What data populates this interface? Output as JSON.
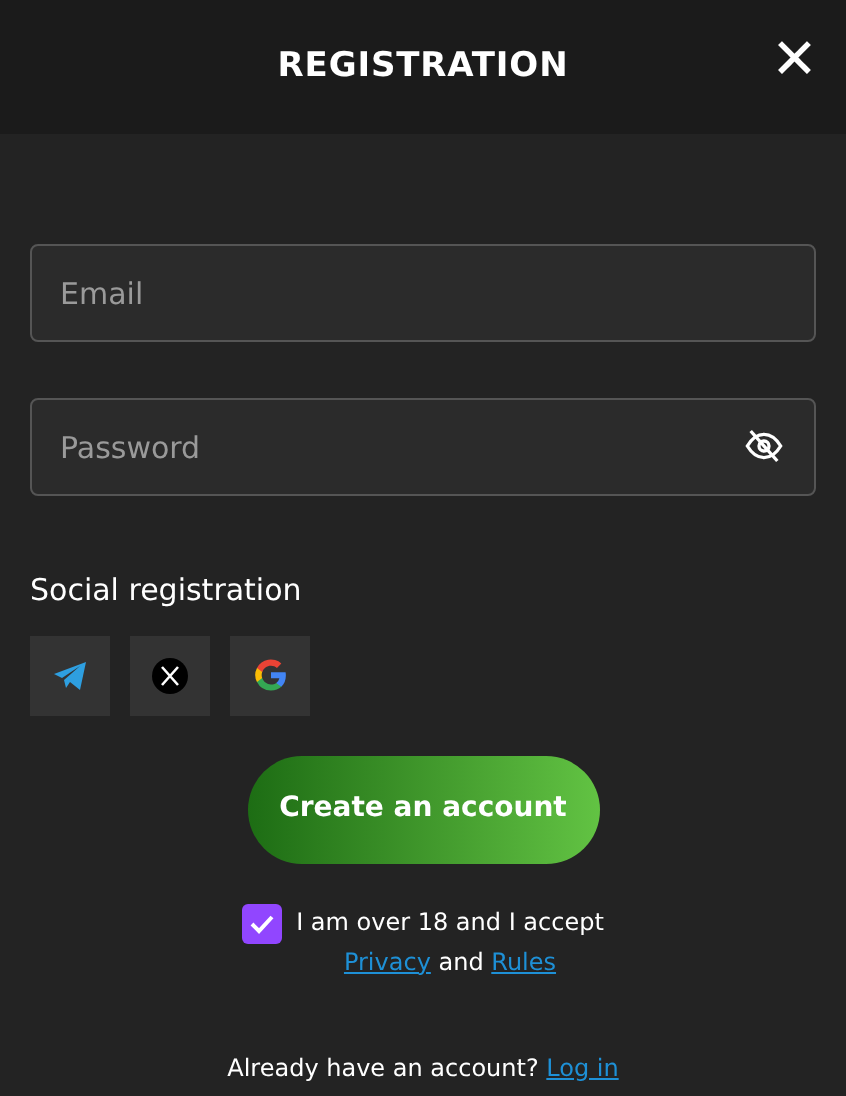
{
  "header": {
    "title": "REGISTRATION",
    "close": "✕"
  },
  "fields": [
    {
      "kind": "email",
      "placeholder": "Email"
    },
    {
      "kind": "password",
      "placeholder": "Password",
      "revealed": false
    }
  ],
  "social": {
    "label": "Social registration",
    "providers": [
      {
        "kind": "telegram"
      },
      {
        "kind": "x"
      },
      {
        "kind": "google"
      }
    ]
  },
  "submit": "Create an account",
  "consent": {
    "checked": true,
    "text": "I am over 18 and I accept",
    "privacy_link": "Privacy",
    "joiner": "and",
    "rules_link": "Rules"
  },
  "login": {
    "text": "Already have an account?",
    "link": "Log in"
  }
}
